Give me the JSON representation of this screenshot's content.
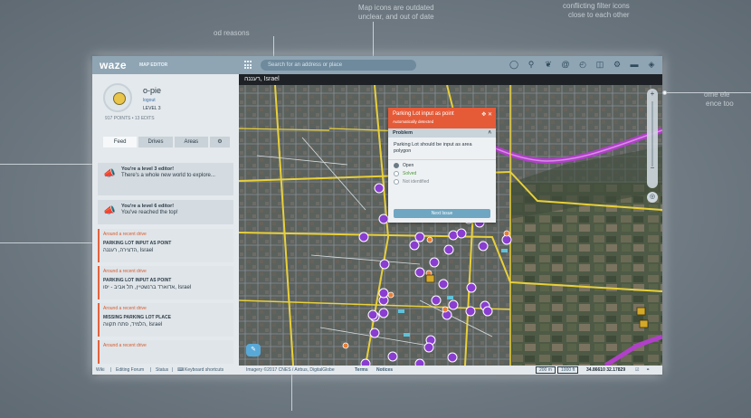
{
  "app": {
    "logo": "waze",
    "logo_sub": "MAP EDITOR"
  },
  "search": {
    "placeholder": "Search for an address or place"
  },
  "toolbar": {
    "icons": [
      "chat-icon",
      "place-icon",
      "leaf-icon",
      "at-icon",
      "clock-icon",
      "save-icon",
      "car-icon",
      "trash-icon",
      "layers-icon"
    ]
  },
  "user": {
    "name": "o-pie",
    "logout": "logout",
    "level": "LEVEL 3",
    "points": "917 POINTS • 13 EDITS"
  },
  "tabs": [
    "Feed",
    "Drives",
    "Areas",
    "⚙"
  ],
  "feed": [
    {
      "title": "You're a level 3 editor!",
      "text": "There's a whole new world to explore..."
    },
    {
      "title": "You're a level 6 editor!",
      "text": "You've reached the top!"
    }
  ],
  "alerts": [
    {
      "head": "Around a recent drive",
      "title": "PARKING LOT INPUT AS POINT",
      "loc": "הדצירה, רעננה, Israel"
    },
    {
      "head": "Around a recent drive",
      "title": "PARKING LOT INPUT AS POINT",
      "loc": "אדוארד ברנשטיין, תל אביב - יפו, Israel"
    },
    {
      "head": "Around a recent drive",
      "title": "MISSING PARKING LOT PLACE",
      "loc": "הלמיד, פתח תקווה, Israel"
    },
    {
      "head": "Around a recent drive",
      "title": "",
      "loc": ""
    }
  ],
  "footer": {
    "links": [
      "Wiki",
      "Editing Forum",
      "Status",
      "Keyboard shortcuts"
    ]
  },
  "map": {
    "location": "רעננה, Israel",
    "imagery": "Imagery ©2017 CNES / Airbus, DigitalGlobe",
    "terms": "Terms",
    "notices": "Notices",
    "scale_m": "200 m",
    "scale_ft": "1000 ft",
    "coords": "34.86610 32.17829"
  },
  "issue": {
    "title": "Parking Lot input as point",
    "subtitle": "Automatically detected",
    "section": "Problem",
    "description": "Parking Lot should be input as area polygon",
    "options": [
      "Open",
      "Solved",
      "Not identified"
    ],
    "selected": "Open",
    "next_button": "Next Issue"
  },
  "annotations": [
    "Map icons are outdated",
    "unclear, and out of date",
    "conflicting filter icons",
    "close to each other",
    "ome ele",
    "ence too",
    "od reasons"
  ]
}
